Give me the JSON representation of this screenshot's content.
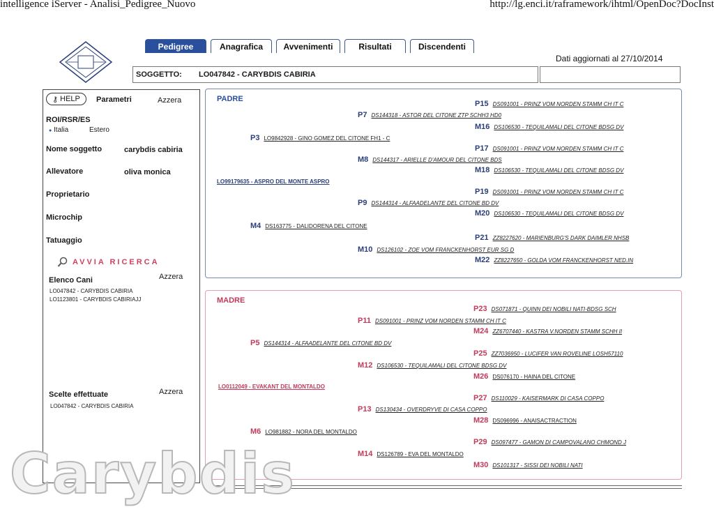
{
  "window": {
    "title": "intelligence iServer - Analisi_Pedigree_Nuovo",
    "url": "http://lg.enci.it/raframework/ihtml/OpenDoc?DocInst"
  },
  "tabs": [
    "Pedigree",
    "Anagrafica",
    "Avvenimenti",
    "Risultati",
    "Discendenti"
  ],
  "updated_label": "Dati aggiornati al 27/10/2014",
  "subject": {
    "label": "SOGGETTO:",
    "value": "LO047842 - CARYBDIS CABIRIA"
  },
  "left": {
    "help": "HELP",
    "params": "Parametri",
    "reset": "Azzera",
    "roi": "ROI/RSR/ES",
    "radio_italia": "Italia",
    "radio_estero": "Estero",
    "name_label": "Nome soggetto",
    "name_value": "carybdis cabiria",
    "breeder_label": "Allevatore",
    "breeder_value": "oliva monica",
    "owner_label": "Proprietario",
    "chip_label": "Microchip",
    "tattoo_label": "Tatuaggio",
    "search": "AVVIA RICERCA",
    "list_title": "Elenco Cani",
    "list_reset": "Azzera",
    "list_items": [
      "LO047842 - CARYBDIS CABIRIA",
      "LO1123801 - CARYBDIS CABIRIAJJ"
    ],
    "choices_title": "Scelte effettuate",
    "choices_reset": "Azzera",
    "choices_items": [
      "LO047842 - CARYBDIS CABIRIA"
    ]
  },
  "padre": {
    "title": "PADRE",
    "root": "LO99179635 - ASPRO DEL MONTE ASPRO",
    "ancestors": [
      {
        "code": "P15",
        "dog": "DS091001 - PRINZ VOM NORDEN STAMM CH IT C"
      },
      {
        "code": "P7",
        "dog": "DS144318 - ASTOR DEL CITONE ZTP SCHH3 HD0"
      },
      {
        "code": "M16",
        "dog": "DS106530 - TEQUILAMALI DEL CITONE BDSG DV"
      },
      {
        "code": "P3",
        "dog": "LO9842928 - GINO GOMEZ DEL CITONE   FH1 - C"
      },
      {
        "code": "P17",
        "dog": "DS091001 - PRINZ VOM NORDEN STAMM CH IT C"
      },
      {
        "code": "M8",
        "dog": "DS144317 - ARIELLE D'AMOUR DEL CITONE BDS"
      },
      {
        "code": "M18",
        "dog": "DS106530 - TEQUILAMALI DEL CITONE BDSG DV"
      },
      {
        "code": "P19",
        "dog": "DS091001 - PRINZ VOM NORDEN STAMM CH IT C"
      },
      {
        "code": "P9",
        "dog": "DS144314 - ALFAADELANTE DEL CITONE BD DV"
      },
      {
        "code": "M20",
        "dog": "DS106530 - TEQUILAMALI DEL CITONE BDSG DV"
      },
      {
        "code": "M4",
        "dog": "DS163775 - DALIDORENA DEL CITONE"
      },
      {
        "code": "P21",
        "dog": "ZZ8227620 - MARIENBURG'S DARK DAIMLER NHSB"
      },
      {
        "code": "M10",
        "dog": "DS126102 - ZOE VOM FRANCKENHORST EUR SG D"
      },
      {
        "code": "M22",
        "dog": "ZZ8227650 - GOLDA VOM FRANCKENHORST NED.IN"
      }
    ]
  },
  "madre": {
    "title": "MADRE",
    "root": "LO0112049 - EVAKANT DEL MONTALDO",
    "ancestors": [
      {
        "code": "P23",
        "dog": "DS071871 - QUINN DEI NOBILI NATI-BDSG SCH"
      },
      {
        "code": "P11",
        "dog": "DS091001 - PRINZ VOM NORDEN STAMM CH IT C"
      },
      {
        "code": "M24",
        "dog": "ZZ6707440 - KASTRA V.NORDEN STAMM SCHH II"
      },
      {
        "code": "P5",
        "dog": "DS144314 - ALFAADELANTE DEL CITONE BD DV"
      },
      {
        "code": "P25",
        "dog": "ZZ7036950 - LUCIFER VAN ROVELINE LOSH57110"
      },
      {
        "code": "M12",
        "dog": "DS106530 - TEQUILAMALI DEL CITONE BDSG DV"
      },
      {
        "code": "M26",
        "dog": "DS076170 - HAINA DEL CITONE"
      },
      {
        "code": "P27",
        "dog": "DS110029 - KAISERMARK DI CASA COPPO"
      },
      {
        "code": "P13",
        "dog": "DS130434 - OVERDRYVE DI CASA COPPO"
      },
      {
        "code": "M28",
        "dog": "DS096996 - ANAISACTRACTION"
      },
      {
        "code": "M6",
        "dog": "LO981882 - NORA DEL MONTALDO"
      },
      {
        "code": "P29",
        "dog": "DS097477 - GAMON DI CAMPOVALANO CHMOND J"
      },
      {
        "code": "M14",
        "dog": "DS126789 - EVA DEL MONTALDO"
      },
      {
        "code": "M30",
        "dog": "DS101317 - SISSI DEI NOBILI NATI"
      }
    ]
  },
  "watermark": "Carybdis"
}
